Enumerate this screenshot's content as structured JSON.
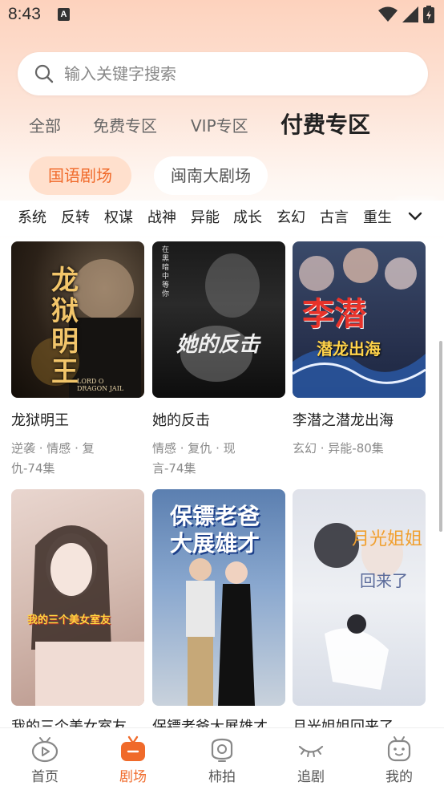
{
  "status_bar": {
    "time": "8:43",
    "notification_letter": "A"
  },
  "search": {
    "placeholder": "输入关键字搜索"
  },
  "top_tabs": [
    {
      "label": "全部"
    },
    {
      "label": "免费专区"
    },
    {
      "label": "VIP专区"
    },
    {
      "label": "付费专区",
      "active": true
    }
  ],
  "sub_tabs": [
    {
      "label": "国语剧场",
      "active": true
    },
    {
      "label": "闽南大剧场"
    }
  ],
  "genres": [
    "系统",
    "反转",
    "权谋",
    "战神",
    "异能",
    "成长",
    "玄幻",
    "古言",
    "重生"
  ],
  "dramas": [
    {
      "title": "龙狱明王",
      "tags_line1": "逆袭 · 情感 · 复",
      "tags_line2": "仇-74集",
      "poster_text": "龙狱明王",
      "poster_subtext": "LORD O\nDRAGON JAIL"
    },
    {
      "title": "她的反击",
      "tags_line1": "情感 · 复仇 · 现",
      "tags_line2": "言-74集",
      "poster_text": "她的反击",
      "poster_subtext": "在黑暗中等你"
    },
    {
      "title": "李潜之潜龙出海",
      "tags_line1": "玄幻 · 异能-80集",
      "tags_line2": "",
      "poster_text": "李潜",
      "poster_subtext": "潜龙出海"
    },
    {
      "title": "我的三个美女室友",
      "poster_text": "我的三个美女室友"
    },
    {
      "title": "保镖老爸大展雄才",
      "poster_text": "保镖老爸",
      "poster_subtext": "大展雄才"
    },
    {
      "title": "月光姐姐回来了",
      "poster_text": "月光姐姐",
      "poster_subtext": "回来了"
    }
  ],
  "bottom_nav": [
    {
      "label": "首页",
      "icon": "tv-home-icon"
    },
    {
      "label": "剧场",
      "icon": "theater-icon",
      "active": true
    },
    {
      "label": "柿拍",
      "icon": "camera-icon"
    },
    {
      "label": "追剧",
      "icon": "eye-closed-icon"
    },
    {
      "label": "我的",
      "icon": "robot-profile-icon"
    }
  ],
  "colors": {
    "accent": "#f06a2a",
    "accent_bg": "#ffe0cd",
    "header_gradient_top": "#fdd2bd"
  }
}
